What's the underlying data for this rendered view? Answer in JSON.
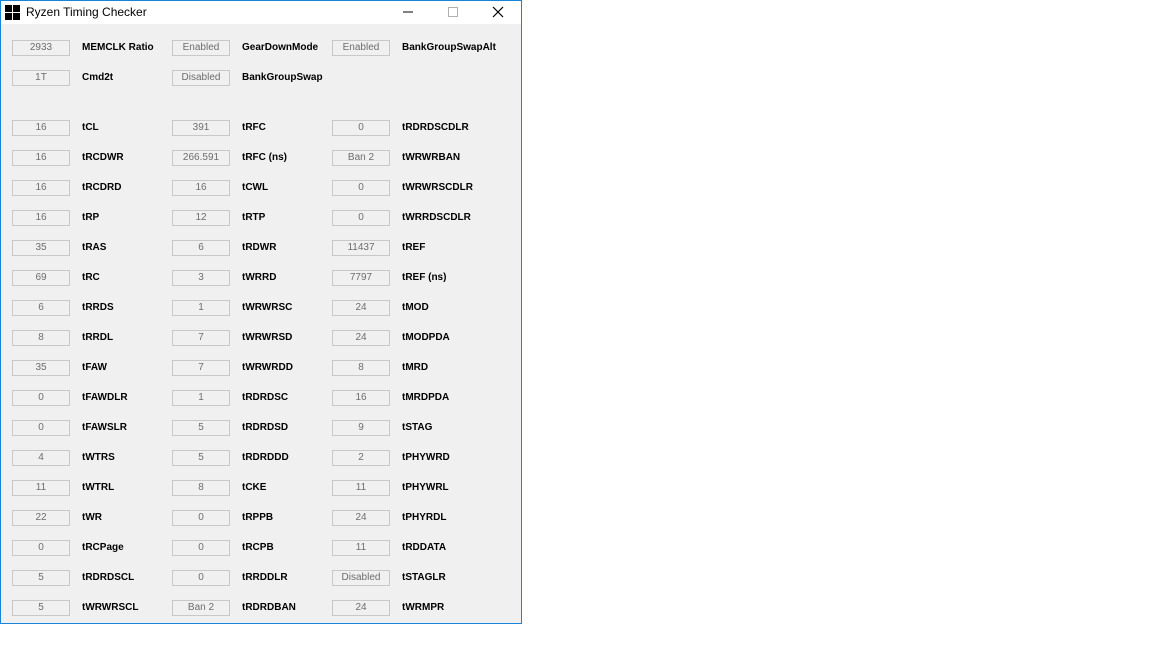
{
  "window": {
    "title": "Ryzen Timing Checker"
  },
  "top_rows": [
    [
      {
        "value": "2933",
        "label": "MEMCLK Ratio"
      },
      {
        "value": "Enabled",
        "label": "GearDownMode"
      },
      {
        "value": "Enabled",
        "label": "BankGroupSwapAlt"
      }
    ],
    [
      {
        "value": "1T",
        "label": "Cmd2t"
      },
      {
        "value": "Disabled",
        "label": "BankGroupSwap"
      }
    ]
  ],
  "timing_rows": [
    [
      {
        "value": "16",
        "label": "tCL"
      },
      {
        "value": "391",
        "label": "tRFC"
      },
      {
        "value": "0",
        "label": "tRDRDSCDLR"
      }
    ],
    [
      {
        "value": "16",
        "label": "tRCDWR"
      },
      {
        "value": "266.591",
        "label": "tRFC (ns)"
      },
      {
        "value": "Ban 2",
        "label": "tWRWRBAN"
      }
    ],
    [
      {
        "value": "16",
        "label": "tRCDRD"
      },
      {
        "value": "16",
        "label": "tCWL"
      },
      {
        "value": "0",
        "label": "tWRWRSCDLR"
      }
    ],
    [
      {
        "value": "16",
        "label": "tRP"
      },
      {
        "value": "12",
        "label": "tRTP"
      },
      {
        "value": "0",
        "label": "tWRRDSCDLR"
      }
    ],
    [
      {
        "value": "35",
        "label": "tRAS"
      },
      {
        "value": "6",
        "label": "tRDWR"
      },
      {
        "value": "11437",
        "label": "tREF"
      }
    ],
    [
      {
        "value": "69",
        "label": "tRC"
      },
      {
        "value": "3",
        "label": "tWRRD"
      },
      {
        "value": "7797",
        "label": "tREF (ns)"
      }
    ],
    [
      {
        "value": "6",
        "label": "tRRDS"
      },
      {
        "value": "1",
        "label": "tWRWRSC"
      },
      {
        "value": "24",
        "label": "tMOD"
      }
    ],
    [
      {
        "value": "8",
        "label": "tRRDL"
      },
      {
        "value": "7",
        "label": "tWRWRSD"
      },
      {
        "value": "24",
        "label": "tMODPDA"
      }
    ],
    [
      {
        "value": "35",
        "label": "tFAW"
      },
      {
        "value": "7",
        "label": "tWRWRDD"
      },
      {
        "value": "8",
        "label": "tMRD"
      }
    ],
    [
      {
        "value": "0",
        "label": "tFAWDLR"
      },
      {
        "value": "1",
        "label": "tRDRDSC"
      },
      {
        "value": "16",
        "label": "tMRDPDA"
      }
    ],
    [
      {
        "value": "0",
        "label": "tFAWSLR"
      },
      {
        "value": "5",
        "label": "tRDRDSD"
      },
      {
        "value": "9",
        "label": "tSTAG"
      }
    ],
    [
      {
        "value": "4",
        "label": "tWTRS"
      },
      {
        "value": "5",
        "label": "tRDRDDD"
      },
      {
        "value": "2",
        "label": "tPHYWRD"
      }
    ],
    [
      {
        "value": "11",
        "label": "tWTRL"
      },
      {
        "value": "8",
        "label": "tCKE"
      },
      {
        "value": "11",
        "label": "tPHYWRL"
      }
    ],
    [
      {
        "value": "22",
        "label": "tWR"
      },
      {
        "value": "0",
        "label": "tRPPB"
      },
      {
        "value": "24",
        "label": "tPHYRDL"
      }
    ],
    [
      {
        "value": "0",
        "label": "tRCPage"
      },
      {
        "value": "0",
        "label": "tRCPB"
      },
      {
        "value": "11",
        "label": "tRDDATA"
      }
    ],
    [
      {
        "value": "5",
        "label": "tRDRDSCL"
      },
      {
        "value": "0",
        "label": "tRRDDLR"
      },
      {
        "value": "Disabled",
        "label": "tSTAGLR"
      }
    ],
    [
      {
        "value": "5",
        "label": "tWRWRSCL"
      },
      {
        "value": "Ban 2",
        "label": "tRDRDBAN"
      },
      {
        "value": "24",
        "label": "tWRMPR"
      }
    ]
  ],
  "colors": {
    "window_border": "#1883d7",
    "client_bg": "#f0f0f0",
    "field_border": "#c8c8c8",
    "field_text": "#6d6d6d"
  }
}
